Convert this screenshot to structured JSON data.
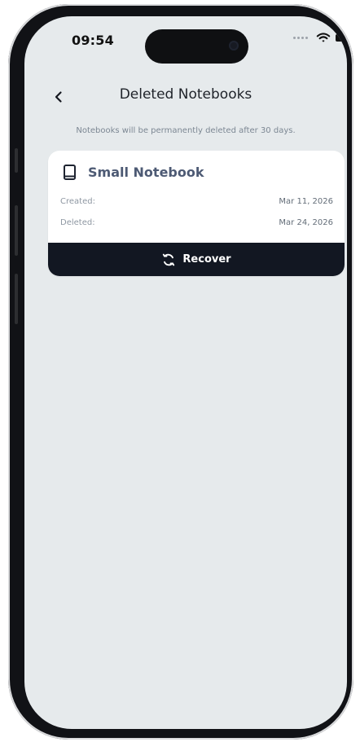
{
  "status": {
    "time": "09:54",
    "icons": [
      "cellular-dots-icon",
      "wifi-icon",
      "battery-icon"
    ]
  },
  "header": {
    "back_icon": "chevron-left-icon",
    "title": "Deleted Notebooks"
  },
  "notice": "Notebooks will be permanently deleted after 30 days.",
  "notebooks": [
    {
      "icon": "book-icon",
      "title": "Small Notebook",
      "created_label": "Created:",
      "created_value": "Mar 11, 2026",
      "deleted_label": "Deleted:",
      "deleted_value": "Mar 24, 2026",
      "action_icon": "refresh-icon",
      "action_label": "Recover"
    }
  ],
  "colors": {
    "background": "#e6eaec",
    "card": "#ffffff",
    "recover_button": "#121722",
    "title_text": "#1f232a",
    "notebook_title": "#4d5a74",
    "secondary_text": "#8e97a2"
  }
}
